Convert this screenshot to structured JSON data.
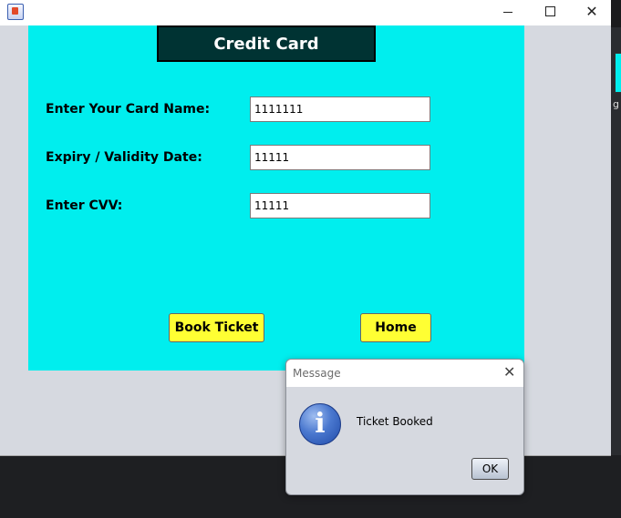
{
  "window": {
    "close_glyph": "✕"
  },
  "background": {
    "partial_text": "g"
  },
  "form": {
    "title": "Credit Card",
    "card_name_label": "Enter Your Card Name:",
    "card_name_value": "1111111",
    "expiry_label": "Expiry / Validity Date:",
    "expiry_value": "11111",
    "cvv_label": "Enter CVV:",
    "cvv_value": "11111",
    "book_button": "Book Ticket",
    "home_button": "Home"
  },
  "dialog": {
    "title": "Message",
    "close_glyph": "✕",
    "icon_glyph": "i",
    "message": "Ticket Booked",
    "ok_label": "OK"
  },
  "colors": {
    "panel": "#00eeee",
    "header": "#003333",
    "button": "#ffff33"
  },
  "icons": [
    "java-app-icon",
    "minimize-icon",
    "maximize-icon",
    "close-icon",
    "info-icon"
  ]
}
